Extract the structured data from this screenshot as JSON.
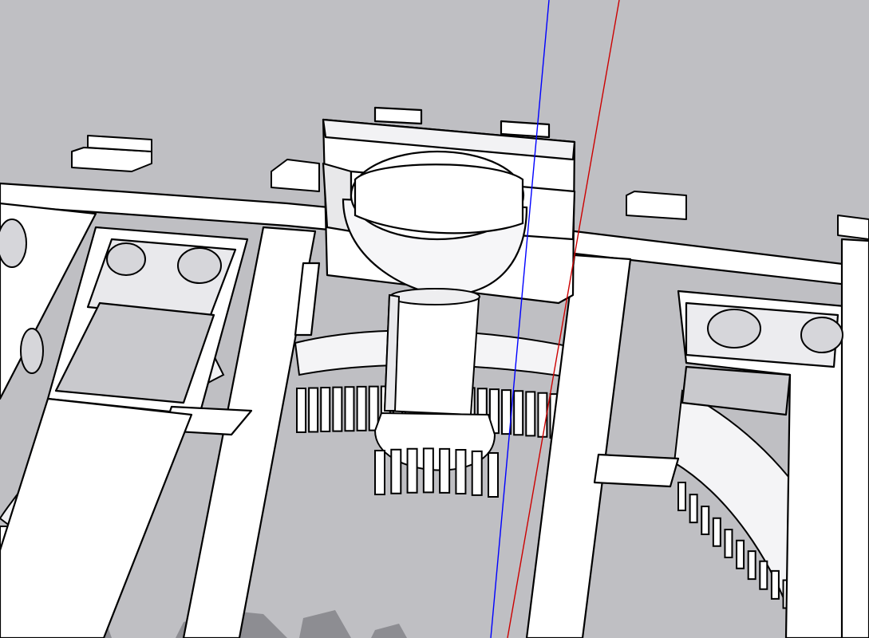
{
  "viewport": {
    "background_color": "#bfbfc3",
    "ground_shade_color": "#cfcfd2",
    "model_fill_color": "#ffffff",
    "shadow_color": "#d4d4d8",
    "deep_shadow_color": "#8d8d92",
    "edge_color": "#000000",
    "axis_blue_color": "#0000ff",
    "axis_red_color": "#cc0000"
  },
  "model": {
    "icons": [
      "gear-train-frame",
      "ring-gear",
      "pinion-gear",
      "motor-mount",
      "shaft"
    ]
  }
}
